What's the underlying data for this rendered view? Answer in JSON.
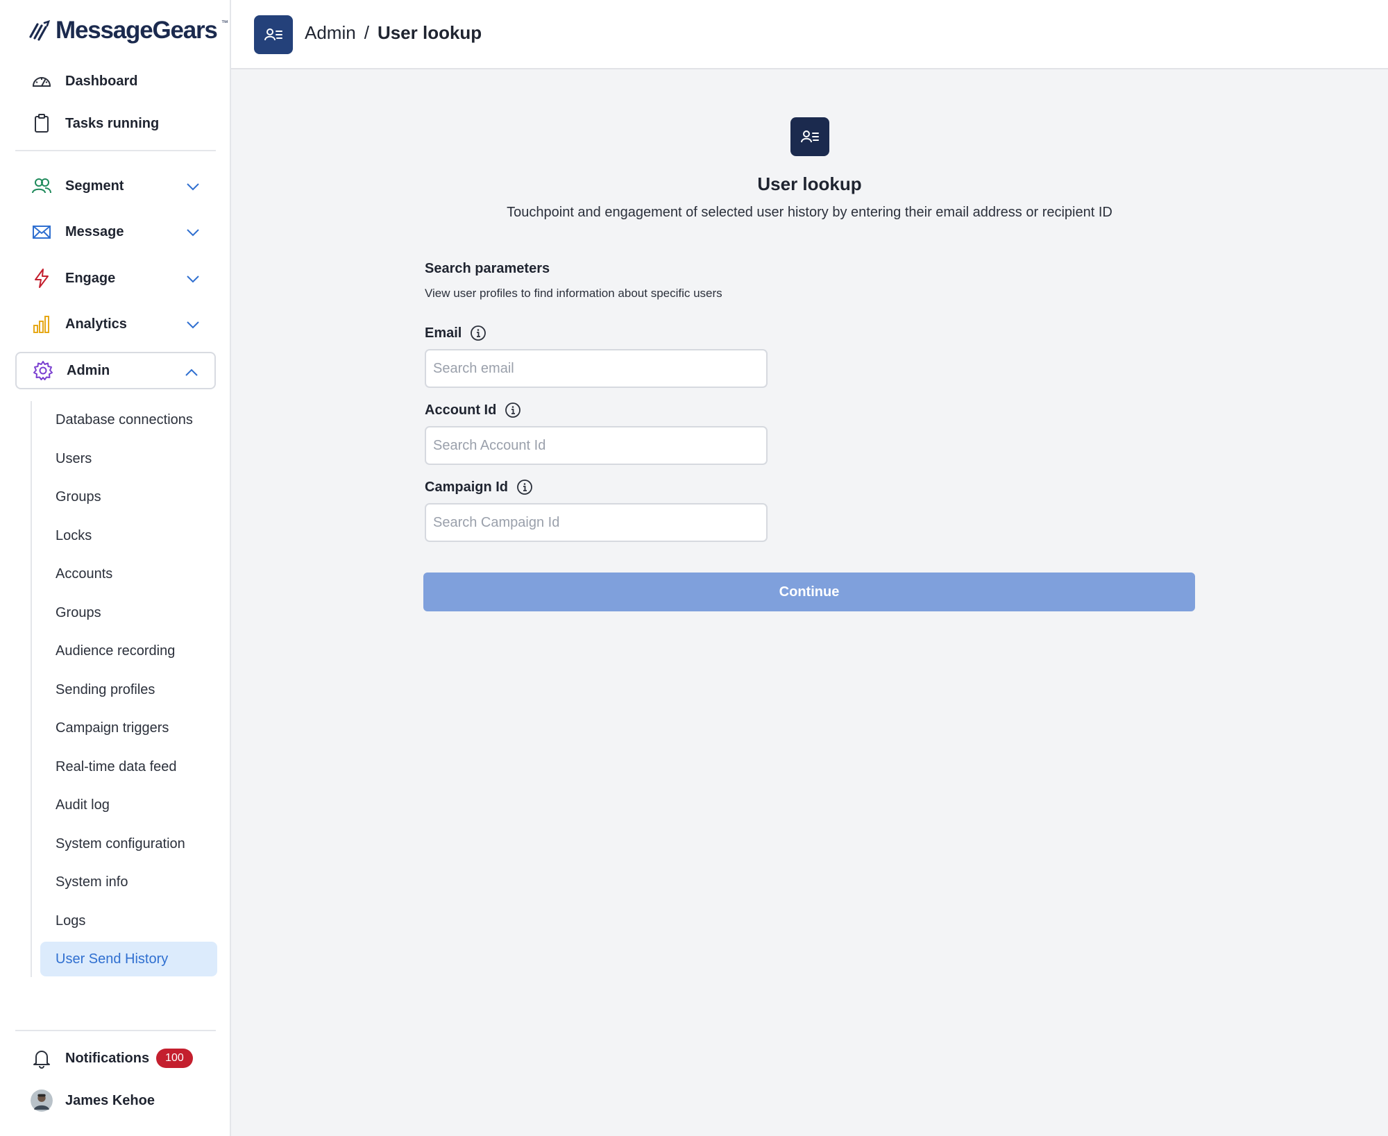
{
  "brand": {
    "name": "MessageGears",
    "tm": "™"
  },
  "sidebar": {
    "top_items": [
      {
        "label": "Dashboard",
        "icon": "gauge-icon"
      },
      {
        "label": "Tasks running",
        "icon": "clipboard-icon"
      }
    ],
    "sections": [
      {
        "label": "Segment",
        "icon": "users-icon",
        "color": "#1f8a5b"
      },
      {
        "label": "Message",
        "icon": "envelope-icon",
        "color": "#2f6fd0"
      },
      {
        "label": "Engage",
        "icon": "lightning-icon",
        "color": "#c41f2e"
      },
      {
        "label": "Analytics",
        "icon": "bar-chart-icon",
        "color": "#e6a817"
      },
      {
        "label": "Admin",
        "icon": "gear-icon",
        "color": "#7a3fd0"
      }
    ],
    "admin_items": [
      "Database connections",
      "Users",
      "Groups",
      "Locks",
      "Accounts",
      "Groups",
      "Audience recording",
      "Sending profiles",
      "Campaign triggers",
      "Real-time data feed",
      "Audit log",
      "System configuration",
      "System info",
      "Logs",
      "User Send History"
    ],
    "active_item": "User Send History",
    "notifications": {
      "label": "Notifications",
      "count": "100"
    },
    "user": {
      "name": "James Kehoe"
    }
  },
  "header": {
    "breadcrumb_parent": "Admin",
    "breadcrumb_sep": "/",
    "breadcrumb_current": "User lookup"
  },
  "main": {
    "title": "User lookup",
    "description": "Touchpoint and engagement of selected user history by entering their email address or recipient ID",
    "section_title": "Search parameters",
    "section_subtitle": "View user profiles to find information about specific users",
    "fields": [
      {
        "label": "Email",
        "placeholder": "Search email",
        "value": ""
      },
      {
        "label": "Account Id",
        "placeholder": "Search Account Id",
        "value": ""
      },
      {
        "label": "Campaign Id",
        "placeholder": "Search Campaign Id",
        "value": ""
      }
    ],
    "continue_label": "Continue"
  },
  "colors": {
    "accent": "#24417a",
    "primary_button": "#7fa0dc",
    "active_item_bg": "#dcebfc",
    "badge": "#c41f2e"
  }
}
